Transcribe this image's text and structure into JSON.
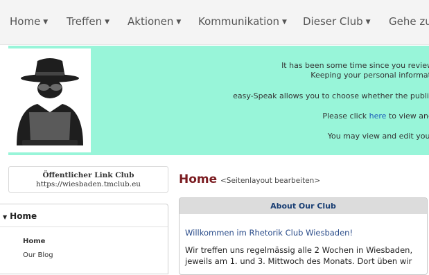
{
  "nav": {
    "items": [
      {
        "label": "Home"
      },
      {
        "label": "Treffen"
      },
      {
        "label": "Aktionen"
      },
      {
        "label": "Kommunikation"
      },
      {
        "label": "Dieser Club"
      },
      {
        "label": "Gehe zu"
      }
    ],
    "caret_icon": "caret-down-icon"
  },
  "banner": {
    "avatar_icon": "spy-hacker-avatar-icon",
    "lines": [
      "It has been some time since you review",
      "Keeping your personal informati",
      "easy-Speak allows you to choose whether the public",
      "Please click",
      "here",
      "to view and",
      "You may view and edit your"
    ],
    "bg_color": "#98f5d9"
  },
  "sidebar": {
    "link_title": "Öffentlicher Link Club",
    "link_url": "https://wiesbaden.tmclub.eu",
    "menu_header": "Home",
    "items": [
      {
        "label": "Home"
      },
      {
        "label": "Our Blog"
      }
    ]
  },
  "main": {
    "title": "Home",
    "edit_link": "<Seitenlayout bearbeiten>",
    "panel_title": "About Our Club",
    "welcome": "Willkommen im Rhetorik Club Wiesbaden!",
    "para_line1": "Wir treffen uns regelmässig alle 2 Wochen in Wiesbaden,",
    "para_line2": "jeweils am 1. und 3. Mittwoch des Monats. Dort üben wir"
  }
}
